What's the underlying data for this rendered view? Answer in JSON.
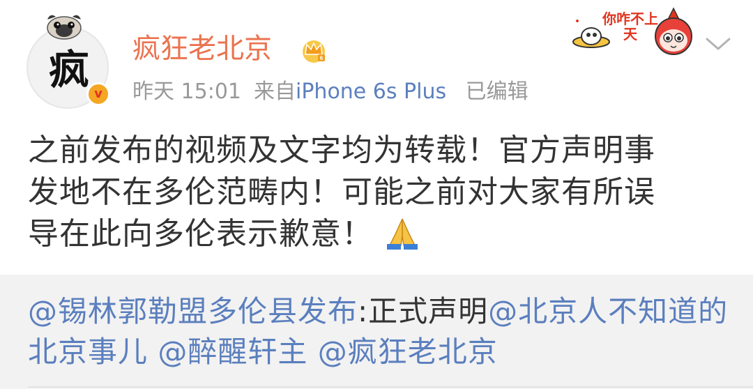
{
  "author": {
    "name": "疯狂老北京",
    "avatar_char": "疯",
    "verified_badge": "v"
  },
  "meta": {
    "time": "昨天 15:01",
    "source_prefix": "来自",
    "device": "iPhone 6s Plus",
    "edited": "已编辑"
  },
  "sticker": {
    "text": "你咋不上天"
  },
  "post": {
    "line1": "之前发布的视频及文字均为转载！官方声明事",
    "line2": "发地不在多伦范畴内！可能之前对大家有所误",
    "line3": "导在此向多伦表示歉意！"
  },
  "repost": {
    "mention1": "@锡林郭勒盟多伦县发布",
    "colon_text": ":正式声明",
    "mention2": "@北京人不知道的北京事儿",
    "mention3": "@醉醒轩主",
    "mention4": "@疯狂老北京"
  },
  "colors": {
    "username": "#eb7350",
    "link": "#5b7fbe",
    "meta": "#999999",
    "repost_bg": "#f2f2f2"
  },
  "icons": {
    "crown": "vip-crown-icon",
    "chevron": "chevron-down-icon",
    "pray": "folded-hands-icon"
  }
}
